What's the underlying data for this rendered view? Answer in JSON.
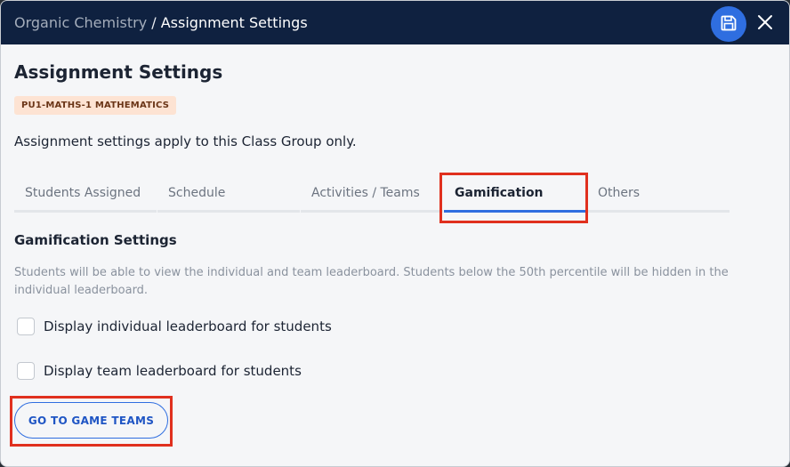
{
  "header": {
    "breadcrumb_parent": "Organic Chemistry",
    "breadcrumb_separator": " / ",
    "breadcrumb_current": "Assignment Settings",
    "save_icon": "save-icon",
    "close_icon": "close-icon"
  },
  "page": {
    "title": "Assignment Settings",
    "badge": "PU1-MATHS-1 MATHEMATICS",
    "scope_note": "Assignment settings apply to this Class Group only."
  },
  "tabs": [
    {
      "label": "Students Assigned",
      "active": false
    },
    {
      "label": "Schedule",
      "active": false
    },
    {
      "label": "Activities / Teams",
      "active": false
    },
    {
      "label": "Gamification",
      "active": true
    },
    {
      "label": "Others",
      "active": false
    }
  ],
  "gamification": {
    "title": "Gamification Settings",
    "description": "Students will be able to view the individual and team leaderboard. Students below the 50th percentile will be hidden in the individual leaderboard.",
    "options": [
      {
        "label": "Display individual leaderboard for students",
        "checked": false
      },
      {
        "label": "Display team leaderboard for students",
        "checked": false
      }
    ],
    "button_label": "GO TO GAME TEAMS"
  },
  "colors": {
    "header_bg": "#0f2140",
    "accent": "#2f6ee0",
    "badge_bg": "#fde3d3",
    "highlight": "#e0301e"
  }
}
